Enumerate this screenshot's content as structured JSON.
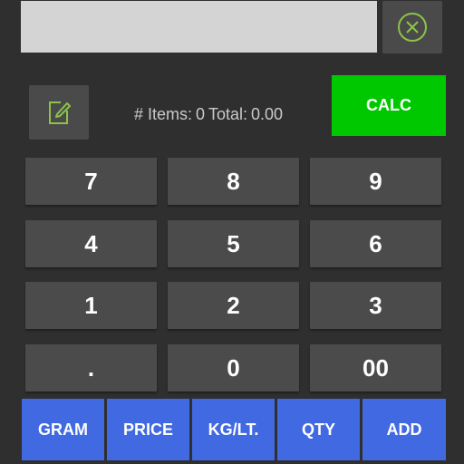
{
  "input": {
    "value": "",
    "placeholder": ""
  },
  "icons": {
    "clear": "close-circle-icon",
    "edit": "edit-note-icon"
  },
  "summary": {
    "items_label": "# Items:",
    "items_count": "0",
    "total_label": "Total:",
    "total_value": "0.00"
  },
  "calc_label": "CALC",
  "keypad": {
    "k7": "7",
    "k8": "8",
    "k9": "9",
    "k4": "4",
    "k5": "5",
    "k6": "6",
    "k1": "1",
    "k2": "2",
    "k3": "3",
    "kdot": ".",
    "k0": "0",
    "k00": "00"
  },
  "functions": {
    "gram": "GRAM",
    "price": "PRICE",
    "kglt": "KG/LT.",
    "qty": "QTY",
    "add": "ADD"
  },
  "colors": {
    "background": "#2f2f2f",
    "key": "#4b4b4b",
    "calc": "#00c800",
    "function": "#4169e1",
    "icon_accent": "#8bc34a"
  }
}
